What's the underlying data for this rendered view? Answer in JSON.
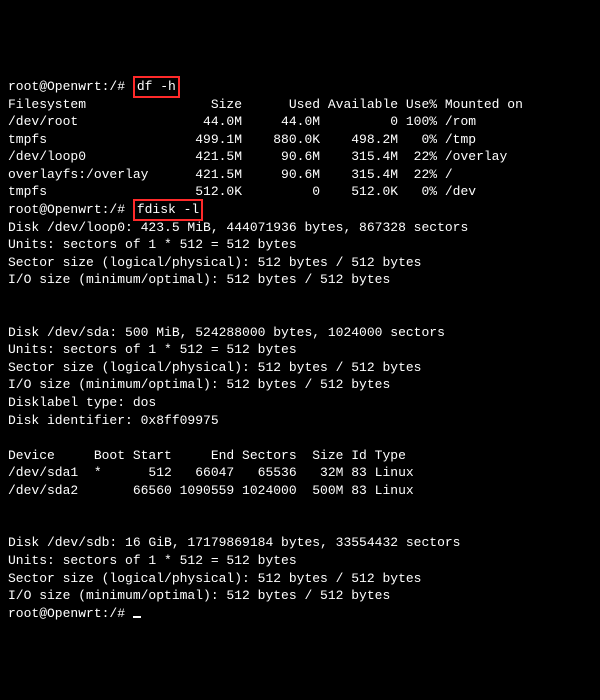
{
  "prompt": "root@Openwrt:/# ",
  "cmd1": "df -h",
  "df_header": "Filesystem                Size      Used Available Use% Mounted on",
  "df_rows": [
    "/dev/root                44.0M     44.0M         0 100% /rom",
    "tmpfs                   499.1M    880.0K    498.2M   0% /tmp",
    "/dev/loop0              421.5M     90.6M    315.4M  22% /overlay",
    "overlayfs:/overlay      421.5M     90.6M    315.4M  22% /",
    "tmpfs                   512.0K         0    512.0K   0% /dev"
  ],
  "cmd2": "fdisk -l",
  "loop0": {
    "l1": "Disk /dev/loop0: 423.5 MiB, 444071936 bytes, 867328 sectors",
    "l2": "Units: sectors of 1 * 512 = 512 bytes",
    "l3": "Sector size (logical/physical): 512 bytes / 512 bytes",
    "l4": "I/O size (minimum/optimal): 512 bytes / 512 bytes"
  },
  "sda": {
    "l1": "Disk /dev/sda: 500 MiB, 524288000 bytes, 1024000 sectors",
    "l2": "Units: sectors of 1 * 512 = 512 bytes",
    "l3": "Sector size (logical/physical): 512 bytes / 512 bytes",
    "l4": "I/O size (minimum/optimal): 512 bytes / 512 bytes",
    "l5": "Disklabel type: dos",
    "l6": "Disk identifier: 0x8ff09975"
  },
  "part_header": "Device     Boot Start     End Sectors  Size Id Type",
  "part_rows": [
    "/dev/sda1  *      512   66047   65536   32M 83 Linux",
    "/dev/sda2       66560 1090559 1024000  500M 83 Linux"
  ],
  "sdb": {
    "l1": "Disk /dev/sdb: 16 GiB, 17179869184 bytes, 33554432 sectors",
    "l2": "Units: sectors of 1 * 512 = 512 bytes",
    "l3": "Sector size (logical/physical): 512 bytes / 512 bytes",
    "l4": "I/O size (minimum/optimal): 512 bytes / 512 bytes"
  }
}
